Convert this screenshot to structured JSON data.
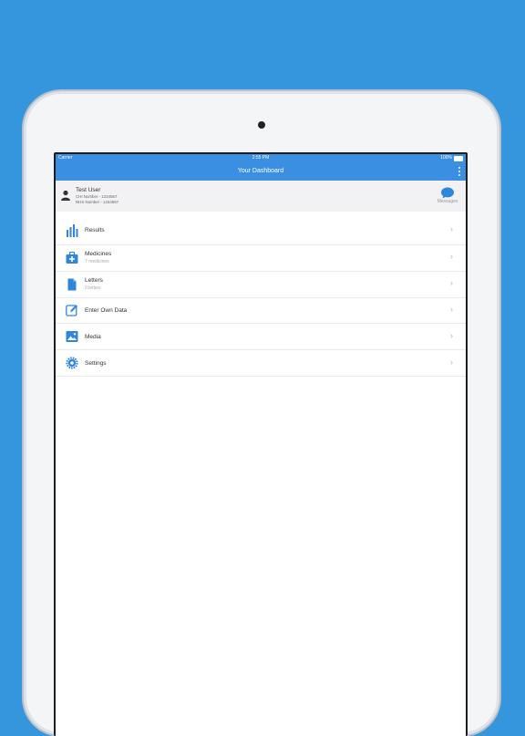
{
  "status_bar": {
    "carrier": "Carrier",
    "time": "2:55 PM",
    "battery": "100%"
  },
  "nav": {
    "title": "Your Dashboard",
    "menu_icon": "kebab-menu-icon"
  },
  "user": {
    "name": "Test User",
    "chi": "CHI Number - 1234567",
    "nhs": "NHS Number - 1234567",
    "messages_label": "Messages"
  },
  "menu": [
    {
      "label": "Results",
      "sub": "",
      "icon": "bar-chart-icon"
    },
    {
      "label": "Medicines",
      "sub": "7 medicines",
      "icon": "medkit-icon"
    },
    {
      "label": "Letters",
      "sub": "0 letters",
      "icon": "document-icon"
    },
    {
      "label": "Enter Own Data",
      "sub": "",
      "icon": "edit-icon"
    },
    {
      "label": "Media",
      "sub": "",
      "icon": "image-icon"
    },
    {
      "label": "Settings",
      "sub": "",
      "icon": "gear-icon"
    }
  ],
  "colors": {
    "background": "#3596dd",
    "accent": "#3a8fe2",
    "icon": "#2f86dc"
  }
}
